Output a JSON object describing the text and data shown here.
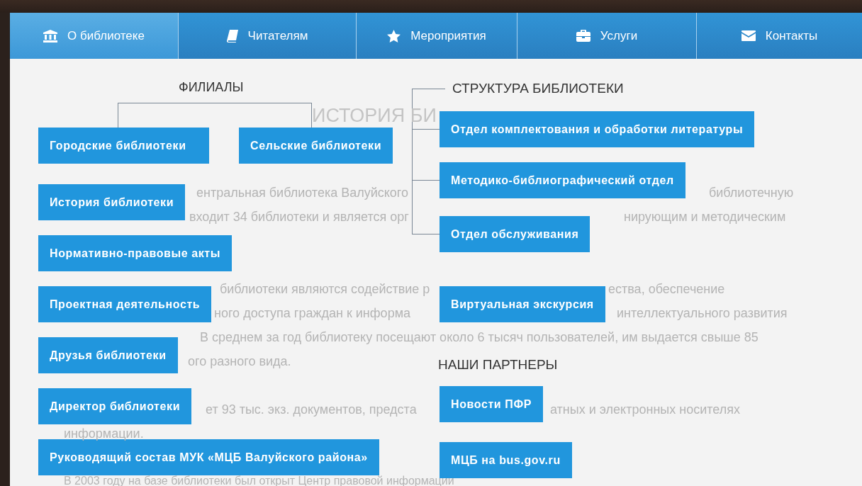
{
  "nav": {
    "tabs": [
      {
        "label": "О библиотеке",
        "selected": true
      },
      {
        "label": "Читателям",
        "selected": false
      },
      {
        "label": "Мероприятия",
        "selected": false
      },
      {
        "label": "Услуги",
        "selected": false
      },
      {
        "label": "Контакты",
        "selected": false
      }
    ]
  },
  "background_text": {
    "heading": "ИСТОРИЯ БИ",
    "lines": [
      {
        "fragments": [
          "ентральная  библиотека Валуйского",
          "библиотечную"
        ]
      },
      {
        "fragments": [
          "входит 34  библиотеки и  является орг",
          "нирующим и методическим"
        ]
      },
      {
        "fragments": [
          "библиотеки являются содействие р",
          "ества, обеспечение"
        ]
      },
      {
        "fragments": [
          "ного доступа граждан к информа",
          "интеллектуального развития"
        ]
      },
      {
        "fragments": [
          "В среднем за год библиотеку посещают около 6 тысяч пользователей, им выдается свыше 85"
        ]
      },
      {
        "fragments": [
          "ого разного вида."
        ]
      },
      {
        "fragments": [
          "ет  93 тыс. экз. документов, предста",
          "атных и электронных носителях"
        ]
      },
      {
        "fragments": [
          "информации."
        ]
      },
      {
        "fragments": [
          "В 2003 году на базе библиотеки был открыт Центр правовой  информации"
        ]
      }
    ]
  },
  "menu": {
    "branches": {
      "title": "ФИЛИАЛЫ",
      "items": [
        "Городские библиотеки",
        "Сельские библиотеки"
      ]
    },
    "links": [
      "История библиотеки",
      "Нормативно-правовые акты",
      "Проектная деятельность",
      "Друзья библиотеки",
      "Директор библиотеки",
      "Руководящий состав МУК «МЦБ Валуйского района»"
    ],
    "structure": {
      "title": "СТРУКТУРА БИБЛИОТЕКИ",
      "items": [
        "Отдел комплектования и обработки литературы",
        "Методико-библиографический отдел",
        "Отдел обслуживания"
      ]
    },
    "extra_links": [
      "Виртуальная экскурсия"
    ],
    "partners": {
      "title": "НАШИ ПАРТНЕРЫ",
      "items": [
        "Новости ПФР",
        "МЦБ на bus.gov.ru"
      ]
    }
  }
}
